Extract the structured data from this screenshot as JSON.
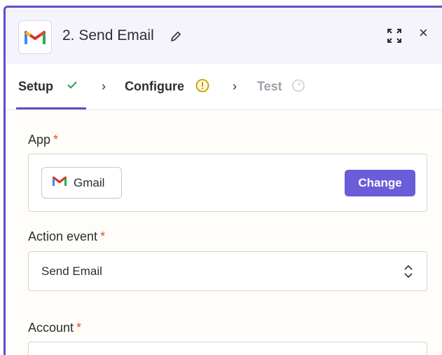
{
  "header": {
    "step_title": "2. Send Email",
    "app_icon": "gmail-logo",
    "edit_icon": "pencil-icon",
    "expand_icon": "expand-icon",
    "close_label": "×"
  },
  "tabs": [
    {
      "label": "Setup",
      "status_icon": "check-icon",
      "state": "active"
    },
    {
      "label": "Configure",
      "status_icon": "warning-icon",
      "state": "default"
    },
    {
      "label": "Test",
      "status_icon": "timer-icon",
      "state": "disabled"
    }
  ],
  "chevron": "›",
  "form": {
    "app": {
      "label": "App",
      "required": "*",
      "value": "Gmail",
      "change_label": "Change"
    },
    "action_event": {
      "label": "Action event",
      "required": "*",
      "value": "Send Email"
    },
    "account": {
      "label": "Account",
      "required": "*"
    }
  },
  "colors": {
    "accent": "#5b4fc7",
    "button": "#6b5dd9",
    "required": "#e24c28",
    "check": "#2e9c5a",
    "warning": "#c99a00"
  }
}
